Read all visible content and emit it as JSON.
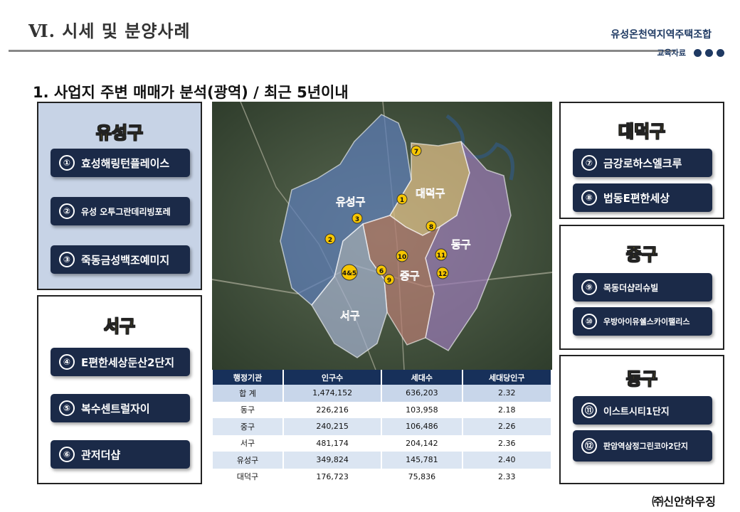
{
  "header": {
    "section_title": "Ⅵ. 시세 및 분양사례",
    "org_name": "유성온천역지역주택조합",
    "edu_label": "교육자료"
  },
  "subtitle": "1. 사업지 주변 매매가 분석(광역) / 최근 5년이내",
  "districts": {
    "yuseong": {
      "title": "유성구",
      "items": [
        {
          "num": "①",
          "label": "효성해링턴플레이스"
        },
        {
          "num": "②",
          "label": "유성 오투그란데리빙포레"
        },
        {
          "num": "③",
          "label": "죽동금성백조예미지"
        }
      ]
    },
    "seo": {
      "title": "서구",
      "items": [
        {
          "num": "④",
          "label": "E편한세상둔산2단지"
        },
        {
          "num": "⑤",
          "label": "복수센트럴자이"
        },
        {
          "num": "⑥",
          "label": "관저더샵"
        }
      ]
    },
    "daedeok": {
      "title": "대덕구",
      "items": [
        {
          "num": "⑦",
          "label": "금강로하스엘크루"
        },
        {
          "num": "⑧",
          "label": "법동E편한세상"
        }
      ]
    },
    "jung": {
      "title": "중구",
      "items": [
        {
          "num": "⑨",
          "label": "목동더샵리슈빌"
        },
        {
          "num": "⑩",
          "label": "우방아이유쉘스카이팰리스"
        }
      ]
    },
    "dong": {
      "title": "동구",
      "items": [
        {
          "num": "⑪",
          "label": "이스트시티1단지"
        },
        {
          "num": "⑫",
          "label": "판암역삼정그린코아2단지"
        }
      ]
    }
  },
  "map": {
    "labels": {
      "yuseong": "유성구",
      "daedeok": "대덕구",
      "dong": "동구",
      "jung": "중구",
      "seo": "서구"
    },
    "markers": [
      "1",
      "2",
      "3",
      "4&5",
      "6",
      "7",
      "8",
      "9",
      "10",
      "11",
      "12"
    ]
  },
  "table": {
    "headers": [
      "행정기관",
      "인구수",
      "세대수",
      "세대당인구"
    ],
    "rows": [
      [
        "합 계",
        "1,474,152",
        "636,203",
        "2.32"
      ],
      [
        "동구",
        "226,216",
        "103,958",
        "2.18"
      ],
      [
        "중구",
        "240,215",
        "106,486",
        "2.26"
      ],
      [
        "서구",
        "481,174",
        "204,142",
        "2.36"
      ],
      [
        "유성구",
        "349,824",
        "145,781",
        "2.40"
      ],
      [
        "대덕구",
        "176,723",
        "75,836",
        "2.33"
      ]
    ]
  },
  "footer": {
    "company": "㈜신안하우징"
  },
  "colors": {
    "navy": "#1b2a48",
    "accent_yellow": "#ffd700",
    "panel_blue": "#c7d3e6"
  }
}
